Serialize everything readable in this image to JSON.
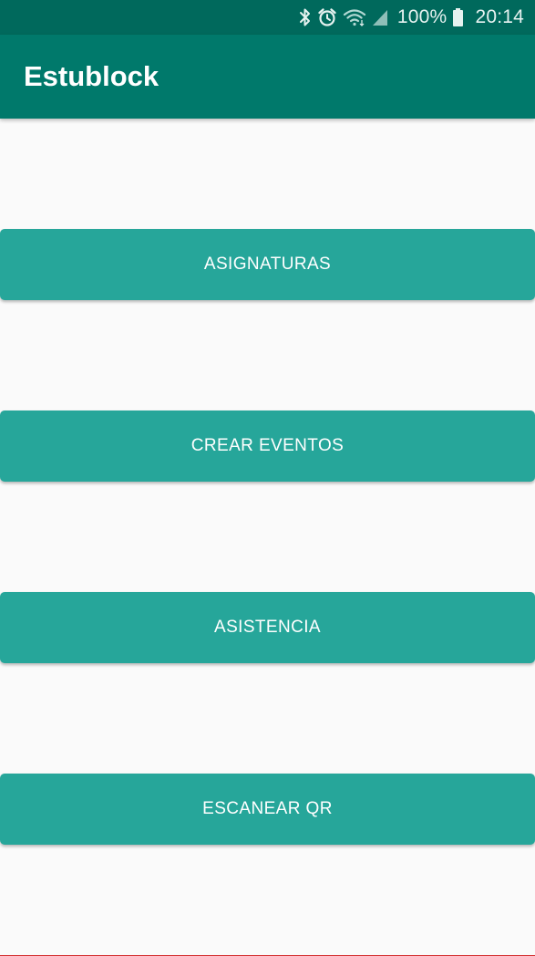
{
  "status_bar": {
    "battery_percent": "100%",
    "time": "20:14",
    "icons": [
      "bluetooth-icon",
      "alarm-icon",
      "wifi-icon",
      "signal-icon",
      "battery-icon"
    ]
  },
  "app_bar": {
    "title": "Estublock"
  },
  "main": {
    "buttons": [
      {
        "label": "ASIGNATURAS"
      },
      {
        "label": "CREAR EVENTOS"
      },
      {
        "label": "ASISTENCIA"
      },
      {
        "label": "ESCANEAR QR"
      }
    ]
  },
  "colors": {
    "status_bar": "#00695c",
    "app_bar": "#00796b",
    "button": "#26a69a",
    "background": "#fafafa"
  }
}
